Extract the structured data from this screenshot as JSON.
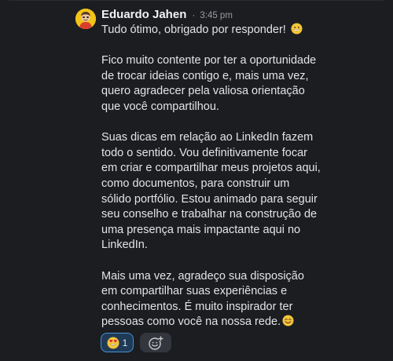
{
  "message": {
    "author": "Eduardo Jahen",
    "separator": "·",
    "time": "3:45 pm",
    "paragraphs": [
      "Tudo ótimo, obrigado por responder!",
      "Fico muito contente por ter a oportunidade de trocar ideias contigo e, mais uma vez, quero agradecer pela valiosa orientação que você compartilhou.",
      "Suas dicas em relação ao LinkedIn fazem todo o sentido. Vou definitivamente focar em criar e compartilhar meus projetos aqui, como documentos, para construir um sólido portfólio. Estou animado para seguir seu conselho e trabalhar na construção de uma presença mais impactante aqui no LinkedIn.",
      "Mais uma vez, agradeço sua disposição em compartilhar suas experiências e conhecimentos. É muito inspirador ter pessoas como você na nossa rede."
    ]
  },
  "reactions": [
    {
      "icon": "heart-eyes-emoji-icon",
      "count": "1"
    }
  ],
  "colors": {
    "background": "#1b1d21",
    "reaction_border": "#4a8fd6",
    "avatar_bg": "#f2c418"
  }
}
